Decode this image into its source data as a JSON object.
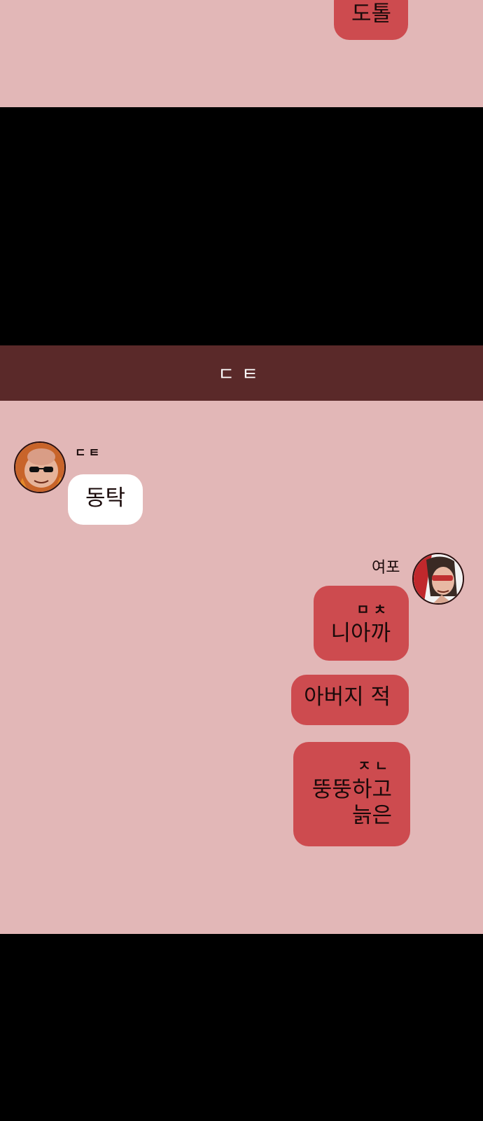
{
  "top_panel": {
    "bubble_text": "도톨"
  },
  "header": {
    "title": "ㄷㅌ"
  },
  "messages": {
    "left_sender": {
      "name": "ㄷㅌ",
      "text": "동탁"
    },
    "right_sender": {
      "name": "여포"
    },
    "right_bubbles": [
      {
        "small": "ㅁㅊ",
        "text": "니아까"
      },
      {
        "text": "아버지 적"
      },
      {
        "small": "ㅈㄴ",
        "line1": "뚱뚱하고",
        "line2": "늙은"
      }
    ]
  },
  "colors": {
    "chat_bg": "#e2b7b7",
    "header_bg": "#5a2929",
    "bubble_red": "#cd4b4f",
    "bubble_white": "#ffffff"
  }
}
